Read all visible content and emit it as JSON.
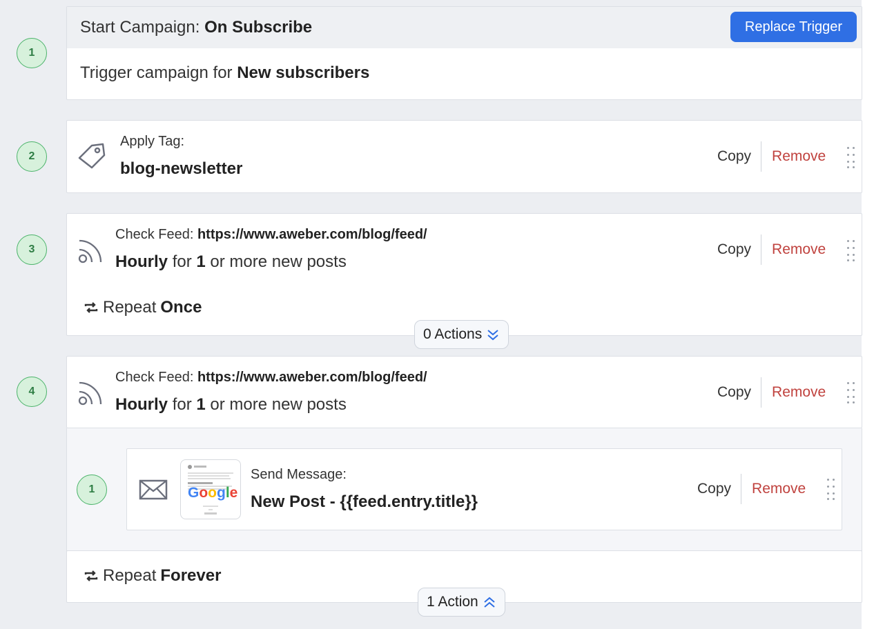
{
  "colors": {
    "accent": "#2f6fe4",
    "remove": "#c0423e",
    "step_badge": "#d7f1dc"
  },
  "trigger": {
    "number": "1",
    "prefix": "Start Campaign:",
    "name": "On Subscribe",
    "replace_label": "Replace Trigger",
    "body_prefix": "Trigger campaign for",
    "body_value": "New subscribers"
  },
  "steps": [
    {
      "number": "2",
      "icon": "tag-icon",
      "label": "Apply Tag:",
      "value": "blog-newsletter",
      "copy": "Copy",
      "remove": "Remove"
    },
    {
      "number": "3",
      "icon": "rss-icon",
      "label": "Check Feed:",
      "url": "https://www.aweber.com/blog/feed/",
      "freq": "Hourly",
      "for_text": "for",
      "count": "1",
      "tail": "or more new posts",
      "copy": "Copy",
      "remove": "Remove",
      "repeat_label": "Repeat",
      "repeat_value": "Once",
      "actions_pill": "0 Actions"
    },
    {
      "number": "4",
      "icon": "rss-icon",
      "label": "Check Feed:",
      "url": "https://www.aweber.com/blog/feed/",
      "freq": "Hourly",
      "for_text": "for",
      "count": "1",
      "tail": "or more new posts",
      "copy": "Copy",
      "remove": "Remove",
      "repeat_label": "Repeat",
      "repeat_value": "Forever",
      "actions_pill": "1 Action",
      "sub_action": {
        "number": "1",
        "icon": "envelope-icon",
        "label": "Send Message:",
        "value": "New Post - {{feed.entry.title}}",
        "thumb_logo": "Google",
        "copy": "Copy",
        "remove": "Remove"
      }
    }
  ]
}
